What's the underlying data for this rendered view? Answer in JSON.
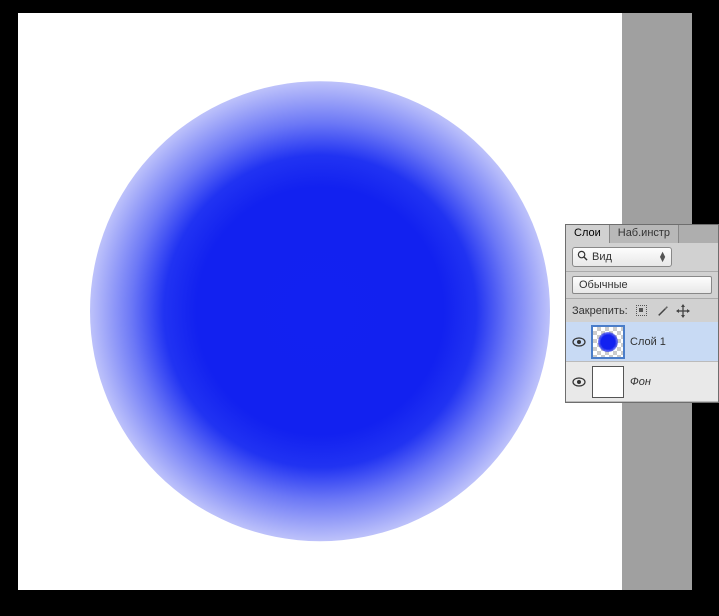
{
  "panel": {
    "tabs": {
      "layers": "Слои",
      "presets": "Наб.инстр"
    },
    "view_dropdown": "Вид",
    "blend_mode": "Обычные",
    "lock_label": "Закрепить:"
  },
  "layers": [
    {
      "name": "Слой 1",
      "visible": true,
      "selected": true,
      "has_circle": true
    },
    {
      "name": "Фон",
      "visible": true,
      "selected": false,
      "has_circle": false
    }
  ]
}
